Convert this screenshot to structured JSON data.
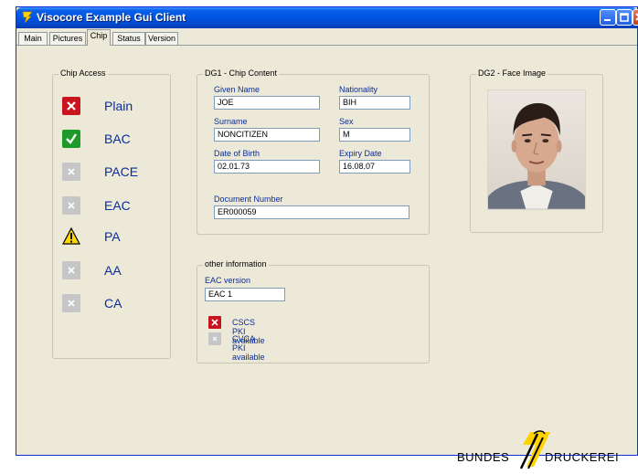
{
  "window": {
    "title": "Visocore Example Gui Client"
  },
  "tabs": [
    {
      "label": "Main",
      "active": false
    },
    {
      "label": "Pictures",
      "active": false
    },
    {
      "label": "Chip",
      "active": true
    },
    {
      "label": "Status",
      "active": false
    },
    {
      "label": "Version",
      "active": false
    }
  ],
  "chip_access": {
    "title": "Chip Access",
    "items": [
      {
        "label": "Plain",
        "status": "fail-red"
      },
      {
        "label": "BAC",
        "status": "ok-green"
      },
      {
        "label": "PACE",
        "status": "disabled-grey"
      },
      {
        "label": "EAC",
        "status": "disabled-grey"
      },
      {
        "label": "PA",
        "status": "warning"
      },
      {
        "label": "AA",
        "status": "disabled-grey"
      },
      {
        "label": "CA",
        "status": "disabled-grey"
      }
    ]
  },
  "dg1": {
    "title": "DG1 - Chip Content",
    "given_name": {
      "label": "Given Name",
      "value": "JOE"
    },
    "nationality": {
      "label": "Nationality",
      "value": "BIH"
    },
    "surname": {
      "label": "Surname",
      "value": "NONCITIZEN"
    },
    "sex": {
      "label": "Sex",
      "value": "M"
    },
    "dob": {
      "label": "Date of Birth",
      "value": "02.01.73"
    },
    "expiry": {
      "label": "Expiry Date",
      "value": "16.08.07"
    },
    "doc_number": {
      "label": "Document Number",
      "value": "ER000059"
    }
  },
  "dg2": {
    "title": "DG2 - Face Image"
  },
  "other": {
    "title": "other information",
    "eac_version": {
      "label": "EAC version",
      "value": "EAC 1"
    },
    "pki": [
      {
        "label": "CSCS PKI available",
        "status": "fail-red"
      },
      {
        "label": "CVCA PKI available",
        "status": "disabled-grey"
      }
    ]
  },
  "logo": {
    "left": "BUNDES",
    "right": "DRUCKEREI"
  },
  "colors": {
    "titlebar": "#0054e3",
    "label_blue": "#0a2d9a",
    "fail_red": "#c8141e",
    "ok_green": "#1f9a2a",
    "disabled_grey": "#c6c6c6",
    "warning_yellow": "#ffd800"
  }
}
